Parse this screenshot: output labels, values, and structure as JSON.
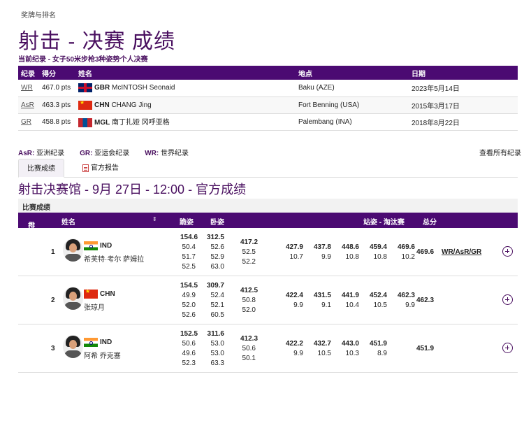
{
  "breadcrumb": "奖牌与排名",
  "page_title": "射击 - 决赛 成绩",
  "records_title": "当前纪录 - 女子50米步枪3种姿势个人决赛",
  "records_headers": {
    "type": "纪录",
    "score": "得分",
    "name": "姓名",
    "location": "地点",
    "date": "日期"
  },
  "records": [
    {
      "type": "WR",
      "score": "467.0 pts",
      "flag": "gbr",
      "noc": "GBR",
      "name": "McINTOSH Seonaid",
      "location": "Baku (AZE)",
      "date": "2023年5月14日"
    },
    {
      "type": "AsR",
      "score": "463.3 pts",
      "flag": "chn",
      "noc": "CHN",
      "name": "CHANG Jing",
      "location": "Fort Benning (USA)",
      "date": "2015年3月17日"
    },
    {
      "type": "GR",
      "score": "458.8 pts",
      "flag": "mgl",
      "noc": "MGL",
      "name": "南丁扎娅 冈呼亚格",
      "location": "Palembang (INA)",
      "date": "2018年8月22日"
    }
  ],
  "legend": [
    {
      "code": "AsR:",
      "text": "亚洲纪录"
    },
    {
      "code": "GR:",
      "text": "亚运会纪录"
    },
    {
      "code": "WR:",
      "text": "世界纪录"
    }
  ],
  "see_all": "查看所有纪录",
  "tabs": {
    "results": "比赛成绩",
    "report": "官方报告"
  },
  "venue_title": "射击决赛馆 - 9月 27日 - 12:00 - 官方成绩",
  "section_label": "比赛成绩",
  "results_headers": {
    "rank": "排名",
    "name": "姓名",
    "kneeling": "跪姿",
    "prone": "卧姿",
    "standing": "站姿 - 淘汰赛",
    "total": "总分"
  },
  "results": [
    {
      "rank": "1",
      "noc": "IND",
      "name": "希芙特·考尔 萨姆拉",
      "kneel_total": "154.6",
      "kneel": [
        "50.4",
        "51.7",
        "52.5"
      ],
      "prone_total": "312.5",
      "prone": [
        "52.6",
        "52.9",
        "63.0"
      ],
      "stand_total": "417.2",
      "stand": [
        "52.5",
        "52.2"
      ],
      "elim": [
        [
          "427.9",
          "10.7"
        ],
        [
          "437.8",
          "9.9"
        ],
        [
          "448.6",
          "10.8"
        ],
        [
          "459.4",
          "10.8"
        ],
        [
          "469.6",
          "10.2"
        ]
      ],
      "total": "469.6",
      "records": "WR/AsR/GR"
    },
    {
      "rank": "2",
      "noc": "CHN",
      "name": "张琼月",
      "kneel_total": "154.5",
      "kneel": [
        "49.9",
        "52.0",
        "52.6"
      ],
      "prone_total": "309.7",
      "prone": [
        "52.4",
        "52.1",
        "60.5"
      ],
      "stand_total": "412.5",
      "stand": [
        "50.8",
        "52.0"
      ],
      "elim": [
        [
          "422.4",
          "9.9"
        ],
        [
          "431.5",
          "9.1"
        ],
        [
          "441.9",
          "10.4"
        ],
        [
          "452.4",
          "10.5"
        ],
        [
          "462.3",
          "9.9"
        ]
      ],
      "total": "462.3",
      "records": ""
    },
    {
      "rank": "3",
      "noc": "IND",
      "name": "阿希 乔克塞",
      "kneel_total": "152.5",
      "kneel": [
        "50.6",
        "49.6",
        "52.3"
      ],
      "prone_total": "311.6",
      "prone": [
        "53.0",
        "53.0",
        "63.3"
      ],
      "stand_total": "412.3",
      "stand": [
        "50.6",
        "50.1"
      ],
      "elim": [
        [
          "422.2",
          "9.9"
        ],
        [
          "432.7",
          "10.5"
        ],
        [
          "443.0",
          "10.3"
        ],
        [
          "451.9",
          "8.9"
        ],
        [
          "",
          ""
        ]
      ],
      "total": "451.9",
      "records": ""
    }
  ]
}
